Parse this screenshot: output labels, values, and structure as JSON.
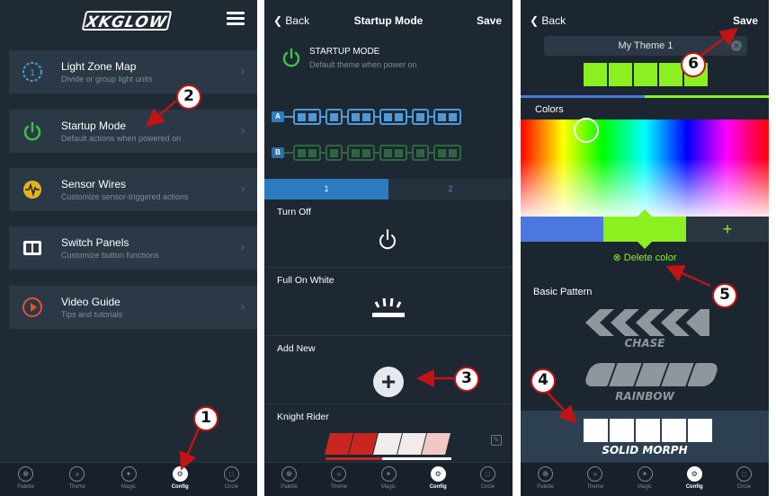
{
  "panel1": {
    "logo": "XKGLOW",
    "menu": [
      {
        "title": "Light Zone Map",
        "subtitle": "Divide or group light units",
        "icon": "zone-map-icon"
      },
      {
        "title": "Startup Mode",
        "subtitle": "Default actions when powered on",
        "icon": "power-icon"
      },
      {
        "title": "Sensor Wires",
        "subtitle": "Customize sensor-triggered actions",
        "icon": "sensor-wave-icon"
      },
      {
        "title": "Switch Panels",
        "subtitle": "Customize button functions",
        "icon": "switch-panel-icon"
      },
      {
        "title": "Video Guide",
        "subtitle": "Tips and tutorials",
        "icon": "play-icon"
      }
    ]
  },
  "panel2": {
    "back": "Back",
    "title": "Startup Mode",
    "save": "Save",
    "header_title": "STARTUP MODE",
    "header_sub": "Default theme when power on",
    "zone_a": "A",
    "zone_b": "B",
    "seg_tabs": [
      "1",
      "2"
    ],
    "options": [
      "Turn Off",
      "Full On White",
      "Add New",
      "Knight Rider"
    ]
  },
  "panel3": {
    "back": "Back",
    "save": "Save",
    "theme_name": "My Theme 1",
    "colors_label": "Colors",
    "add_label": "+",
    "delete_label": "Delete color",
    "basic_pattern_label": "Basic Pattern",
    "patterns": [
      "CHASE",
      "RAINBOW",
      "SOLID MORPH"
    ]
  },
  "tabbar": [
    "Palette",
    "Theme",
    "Magic",
    "Config",
    "Circle"
  ],
  "callouts": [
    "1",
    "2",
    "3",
    "4",
    "5",
    "6"
  ],
  "colors": {
    "accent_green": "#8af020",
    "callout_red": "#c21414",
    "zone_blue": "#4e9ad8",
    "swatch_blue": "#4a78e0"
  }
}
